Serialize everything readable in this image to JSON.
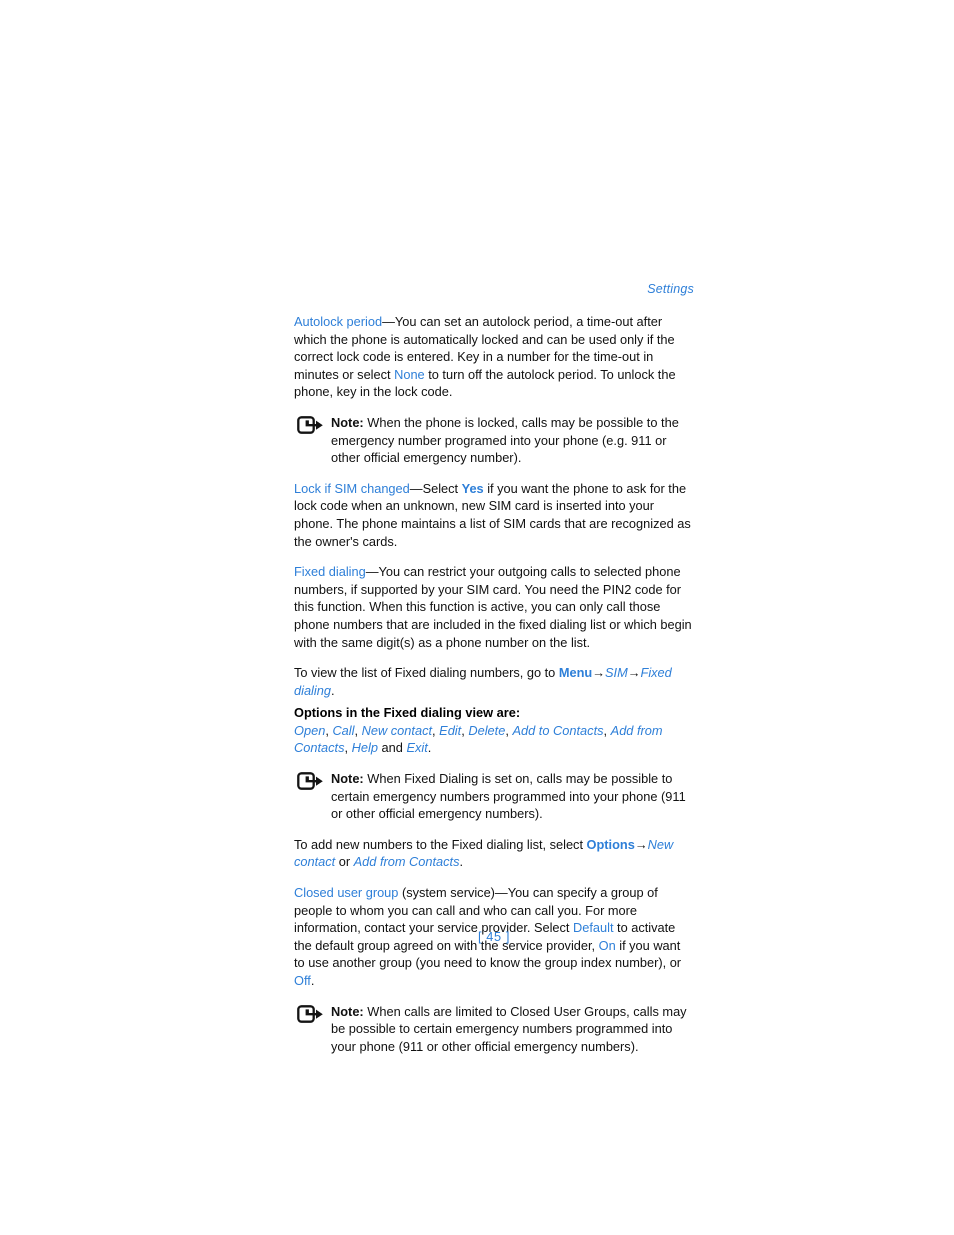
{
  "document": {
    "running_head": "Settings",
    "page_number": "[ 45 ]",
    "accent_color": "#2e7fd8",
    "text_color": "#111111",
    "background_color": "#ffffff"
  },
  "sections": {
    "autolock": {
      "term": "Autolock period",
      "dash": "—",
      "text_1": "You can set an autolock period, a time-out after which the phone is automatically locked and can be used only if the correct lock code is entered. Key in a number for the time-out in minutes or select ",
      "value_none": "None",
      "text_2": " to turn off the autolock period. To unlock the phone, key in the lock code."
    },
    "note_1": {
      "icon": "note-arrow-icon",
      "label": "Note:",
      "text": " When the phone is locked, calls may be possible to the emergency number programed into your phone (e.g. 911 or other official emergency number)."
    },
    "lock_if_sim": {
      "term": "Lock if SIM changed",
      "dash": "—",
      "text_1": "Select ",
      "value_yes": "Yes",
      "text_2": " if you want the phone to ask for the lock code when an unknown, new SIM card is inserted into your phone. The phone maintains a list of SIM cards that are recognized as the owner's cards."
    },
    "fixed_dialing": {
      "term": "Fixed dialing",
      "dash": "—",
      "text": "You can restrict your outgoing calls to selected phone numbers, if supported by your SIM card. You need the PIN2 code for this function. When this function is active, you can only call those phone numbers that are included in the fixed dialing list or which begin with the same digit(s) as a phone number on the list."
    },
    "view_list": {
      "text_1": "To view the list of Fixed dialing numbers, go to ",
      "menu": "Menu",
      "arrow_1": "→",
      "sim": "SIM",
      "arrow_2": "→",
      "fixed_dialing": "Fixed dialing",
      "period": "."
    },
    "options_view": {
      "heading": "Options in the Fixed dialing view are:",
      "items": [
        "Open",
        "Call",
        "New contact",
        "Edit",
        "Delete",
        "Add to Contacts",
        "Add from Contacts",
        "Help",
        "Exit"
      ],
      "separator": ", ",
      "conjunction": " and ",
      "period": "."
    },
    "note_2": {
      "icon": "note-arrow-icon",
      "label": "Note:",
      "text": " When Fixed Dialing is set on, calls may be possible to certain emergency numbers programmed into your phone (911 or other official emergency numbers)."
    },
    "add_numbers": {
      "text_1": "To add new numbers to the Fixed dialing list, select ",
      "options": "Options",
      "arrow": "→",
      "new_contact": "New contact",
      "text_2": " or ",
      "add_from_contacts": "Add from Contacts",
      "period": "."
    },
    "closed_user_group": {
      "term": "Closed user group",
      "text_1": " (system service)—You can specify a group of people to whom you can call and who can call you. For more information, contact your service provider. Select ",
      "value_default": "Default",
      "text_2": " to activate the default group agreed on with the service provider, ",
      "value_on": "On",
      "text_3": " if you want to use another group (you need to know the group index number), or ",
      "value_off": "Off",
      "text_4": "."
    },
    "note_3": {
      "icon": "note-arrow-icon",
      "label": "Note:",
      "text": " When calls are limited to Closed User Groups, calls may be possible to certain emergency numbers programmed into your phone (911 or other official emergency numbers)."
    }
  }
}
